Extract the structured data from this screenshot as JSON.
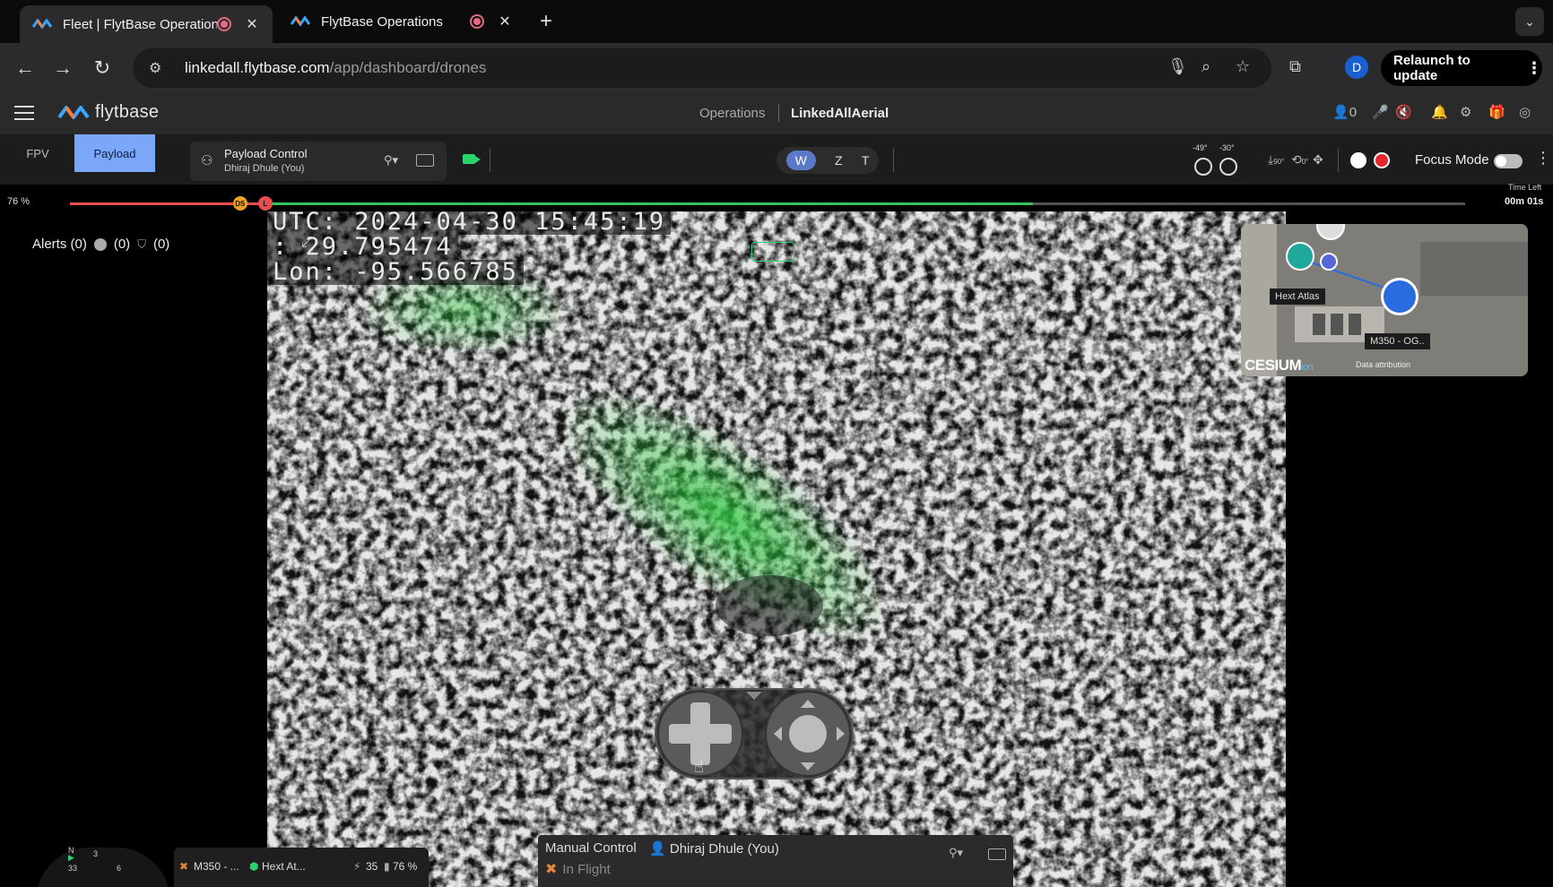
{
  "browser": {
    "tabs": [
      {
        "title": "Fleet | FlytBase Operations",
        "active": true
      },
      {
        "title": "FlytBase Operations",
        "active": false
      }
    ],
    "new_tab_icon": "plus-icon",
    "url_host": "linkedall.flytbase.com",
    "url_path": "/app/dashboard/drones",
    "profile_initial": "D",
    "relaunch_label": "Relaunch to update"
  },
  "app": {
    "brand": "flytbase",
    "breadcrumb": {
      "section": "Operations",
      "org": "LinkedAllAerial"
    },
    "user_count": "0"
  },
  "controls": {
    "view_tabs": {
      "fpv": "FPV",
      "payload": "Payload"
    },
    "payload_card": {
      "title": "Payload Control",
      "user": "Dhiraj Dhule (You)"
    },
    "zoom_modes": [
      "W",
      "Z",
      "T"
    ],
    "zoom_active": "W",
    "gimbal_angles": [
      "-49°",
      "-30°"
    ],
    "angle_90": "90°",
    "angle_0": "0°",
    "focus_mode_label": "Focus Mode",
    "focus_mode_on": false
  },
  "progress": {
    "percent_label": "76 %",
    "red_fraction": 0.14,
    "green_end_fraction": 0.69,
    "markers": [
      {
        "label": "DS",
        "color": "#f0a020",
        "position": 0.122
      },
      {
        "label": "L",
        "color": "#e84d4d",
        "position": 0.14
      }
    ],
    "time_left_label": "Time Left",
    "time_left_value": "00m 01s"
  },
  "alerts": {
    "label": "Alerts (0)",
    "count_a": "(0)",
    "count_b": "(0)"
  },
  "video": {
    "osd_utc": "UTC: 2024-04-30 15:45:19",
    "osd_lat": ": 29.795474",
    "osd_lon": "Lon: -95.566785"
  },
  "minimap": {
    "site_label": "Hext Atlas",
    "drone_label": "M350 - OG..",
    "provider": "CESIUM",
    "provider_suffix": "ion",
    "attribution": "Data attribution"
  },
  "manual_control": {
    "title": "Manual Control",
    "user": "Dhiraj Dhule (You)",
    "status": "In Flight"
  },
  "drone_card": {
    "name": "M350 - ...",
    "site": "Hext At...",
    "satellites": "35",
    "battery": "76 %"
  },
  "compass": {
    "n": "N",
    "left": "33",
    "mid": "3",
    "right": "6"
  },
  "colors": {
    "accent_blue": "#7aa7f8",
    "record_red": "#e8282c",
    "live_green": "#2ad36b"
  }
}
